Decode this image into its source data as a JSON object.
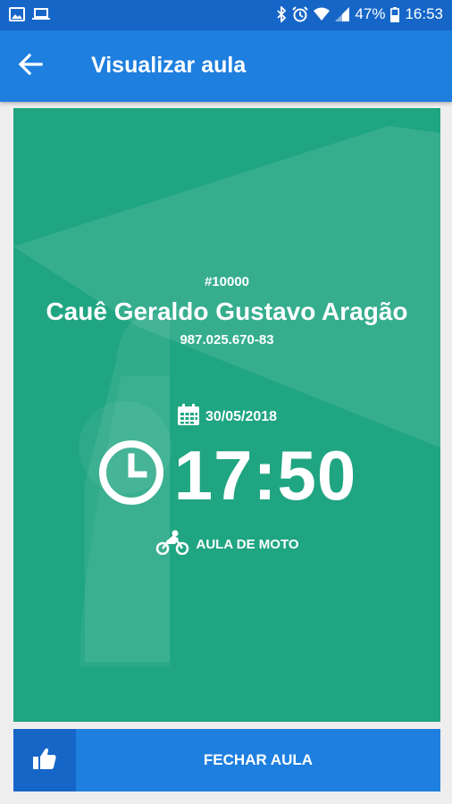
{
  "status_bar": {
    "battery": "47%",
    "time": "16:53",
    "icons": [
      "image-icon",
      "laptop-icon",
      "bluetooth-icon",
      "alarm-icon",
      "wifi-icon",
      "signal-icon",
      "battery-icon"
    ]
  },
  "app_bar": {
    "title": "Visualizar aula",
    "back_icon": "arrow-left-icon"
  },
  "lesson": {
    "id": "#10000",
    "student_name": "Cauê Geraldo Gustavo Aragão",
    "student_document": "987.025.670-83",
    "date": "30/05/2018",
    "time": "17:50",
    "type": "AULA DE MOTO"
  },
  "actions": {
    "close_label": "FECHAR AULA",
    "close_icon": "thumbs-up-icon"
  },
  "colors": {
    "status_bar": "#1666c8",
    "app_bar": "#1e7fdf",
    "card": "#20a582",
    "background": "#eeeeee"
  }
}
